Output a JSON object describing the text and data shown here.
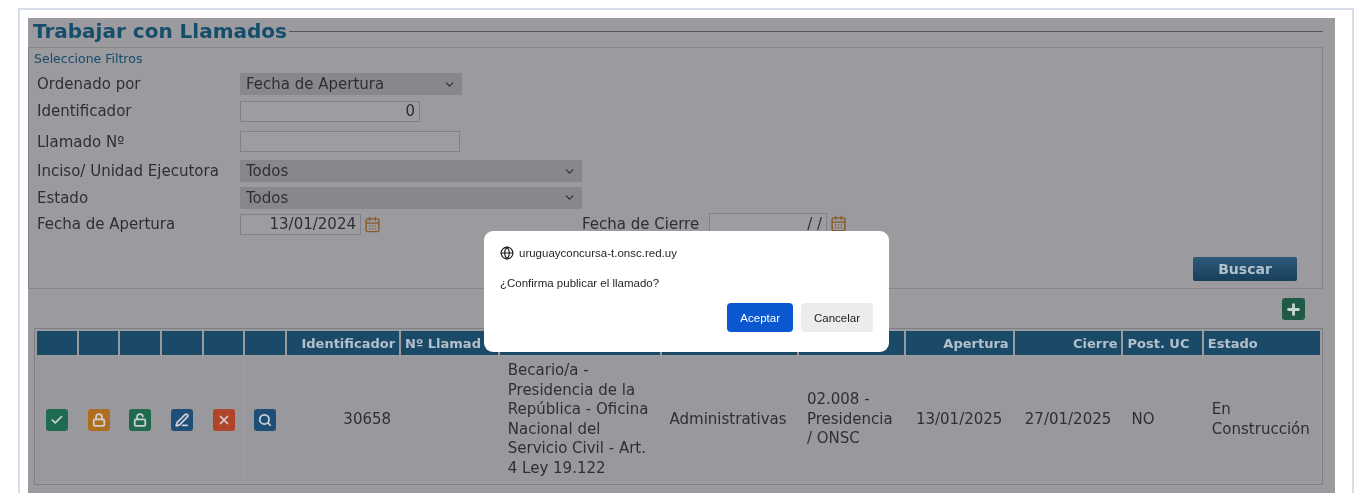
{
  "page": {
    "title": "Trabajar con Llamados"
  },
  "filters": {
    "legend": "Seleccione Filtros",
    "fields": [
      {
        "kind": "select",
        "label": "Ordenado por",
        "value": "Fecha de Apertura"
      },
      {
        "kind": "number",
        "label": "Identificador",
        "value": "0"
      },
      {
        "kind": "text",
        "label": "Llamado Nº"
      },
      {
        "kind": "wide-select",
        "label": "Inciso/ Unidad Ejecutora",
        "value": "Todos"
      },
      {
        "kind": "wide-select",
        "label": "Estado",
        "value": "Todos"
      },
      {
        "kind": "date",
        "label": "Fecha de Apertura",
        "value": "13/01/2024"
      }
    ],
    "closing_date": {
      "label": "Fecha de Cierre",
      "value": "/ /"
    },
    "search_button": "Buscar"
  },
  "table": {
    "columns": [
      {
        "kind": "action"
      },
      {
        "kind": "action"
      },
      {
        "kind": "action"
      },
      {
        "kind": "action"
      },
      {
        "kind": "action"
      },
      {
        "kind": "action"
      },
      {
        "kind": "text",
        "label": "Identificador"
      },
      {
        "kind": "text",
        "label": "Nº Llamad"
      },
      {
        "kind": "covered"
      },
      {
        "kind": "covered"
      },
      {
        "kind": "covered"
      },
      {
        "kind": "text",
        "label": "Apertura"
      },
      {
        "kind": "text",
        "label": "Cierre"
      },
      {
        "kind": "text",
        "label": "Post. UC"
      },
      {
        "kind": "text",
        "label": "Estado"
      }
    ],
    "rows": [
      {
        "cells": [
          {
            "kind": "approve"
          },
          {
            "kind": "lock"
          },
          {
            "kind": "unlock"
          },
          {
            "kind": "edit"
          },
          {
            "kind": "delete"
          },
          {
            "kind": "view"
          },
          {
            "kind": "text",
            "text": "30658"
          },
          {
            "kind": "empty"
          },
          {
            "kind": "text",
            "text": "Becario/a - Presidencia de la República - Oficina Nacional del Servicio Civil - Art. 4 Ley 19.122"
          },
          {
            "kind": "text",
            "text": "Administrativas"
          },
          {
            "kind": "text",
            "text": "02.008 - Presidencia / ONSC"
          },
          {
            "kind": "text",
            "text": "13/01/2025"
          },
          {
            "kind": "text",
            "text": "27/01/2025"
          },
          {
            "kind": "text",
            "text": "NO"
          },
          {
            "kind": "text",
            "text": "En Construcción"
          }
        ]
      }
    ]
  },
  "dialog": {
    "origin": "uruguayconcursa-t.onsc.red.uy",
    "message": "¿Confirma publicar el llamado?",
    "buttons": [
      {
        "label": "Aceptar",
        "primary": true
      },
      {
        "label": "Cancelar",
        "primary": false
      }
    ]
  }
}
